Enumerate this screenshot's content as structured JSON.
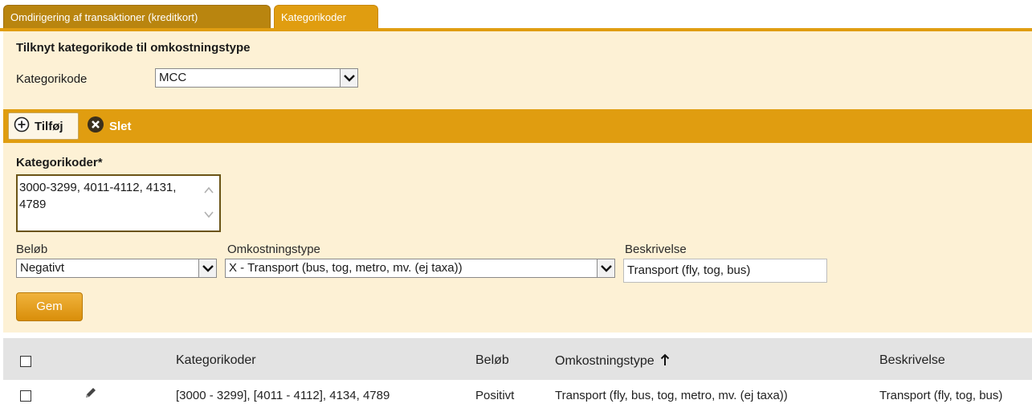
{
  "tabs": [
    {
      "label": "Omdirigering af transaktioner (kreditkort)",
      "active": false
    },
    {
      "label": "Kategorikoder",
      "active": true
    }
  ],
  "section": {
    "title": "Tilknyt kategorikode til omkostningstype",
    "kategorikode_label": "Kategorikode",
    "kategorikode_value": "MCC"
  },
  "toolbar": {
    "add_label": "Tilføj",
    "delete_label": "Slet"
  },
  "form": {
    "kategorikoder_label": "Kategorikoder*",
    "kategorikoder_value": "3000-3299, 4011-4112, 4131, 4789",
    "belob_label": "Beløb",
    "belob_value": "Negativt",
    "omkostningstype_label": "Omkostningstype",
    "omkostningstype_value": "X - Transport (bus, tog, metro, mv. (ej taxa))",
    "beskrivelse_label": "Beskrivelse",
    "beskrivelse_value": "Transport (fly, tog, bus)",
    "save_label": "Gem"
  },
  "table": {
    "headers": {
      "kategorikoder": "Kategorikoder",
      "belob": "Beløb",
      "omkostningstype": "Omkostningstype",
      "beskrivelse": "Beskrivelse"
    },
    "sort_icon": "arrow-up-icon",
    "rows": [
      {
        "kategorikoder": "[3000 - 3299], [4011 - 4112], 4134, 4789",
        "belob": "Positivt",
        "omkostningstype": "Transport (fly, bus, tog, metro, mv. (ej taxa))",
        "beskrivelse": "Transport (fly, tog, bus)"
      }
    ]
  },
  "colors": {
    "accent": "#e09d10",
    "tab_inactive": "#b9850f",
    "panel_background": "#fdf1d5",
    "table_header": "#e3e3e3",
    "delete_icon": "#3a2f1c"
  }
}
